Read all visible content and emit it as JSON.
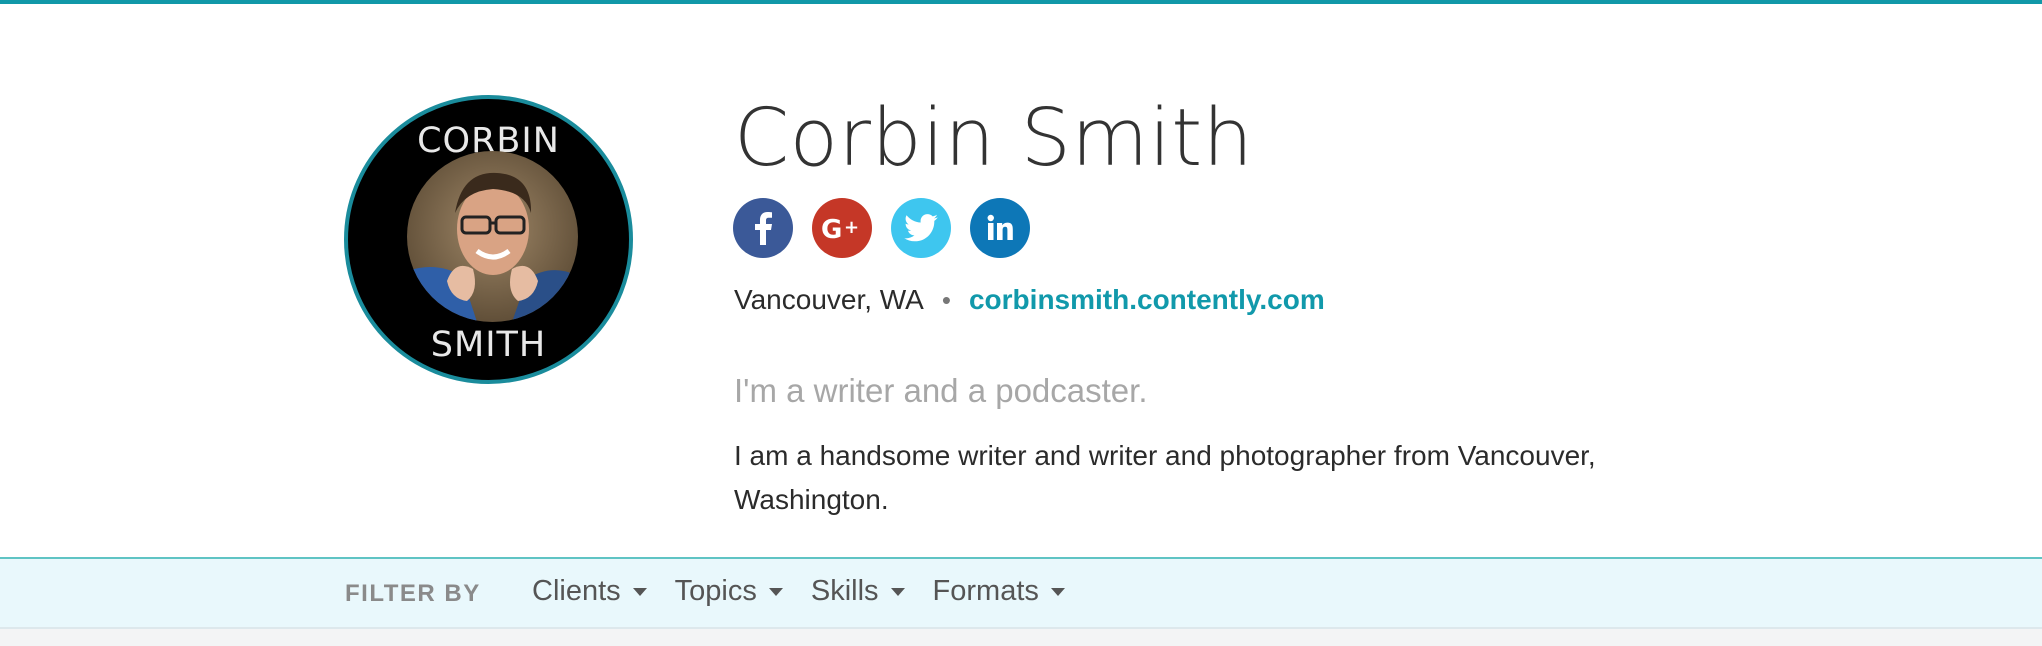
{
  "profile": {
    "avatar_top_text": "CORBIN",
    "avatar_bottom_text": "SMITH",
    "name": "Corbin Smith",
    "location": "Vancouver, WA",
    "separator": "•",
    "website": "corbinsmith.contently.com",
    "tagline": "I'm a writer and a podcaster.",
    "bio": "I am a handsome writer and writer and photographer from Vancouver, Washington."
  },
  "social": [
    {
      "name": "facebook",
      "icon": "facebook-icon",
      "color": "#3b5998"
    },
    {
      "name": "google-plus",
      "icon": "google-plus-icon",
      "color": "#c53727"
    },
    {
      "name": "twitter",
      "icon": "twitter-icon",
      "color": "#3ec6ef"
    },
    {
      "name": "linkedin",
      "icon": "linkedin-icon",
      "color": "#0d77b7"
    }
  ],
  "filter_bar": {
    "label": "FILTER BY",
    "items": [
      {
        "label": "Clients"
      },
      {
        "label": "Topics"
      },
      {
        "label": "Skills"
      },
      {
        "label": "Formats"
      }
    ]
  },
  "colors": {
    "accent": "#1199ab",
    "top_rule": "#1198a8",
    "filter_bg": "#e9f8fc"
  }
}
